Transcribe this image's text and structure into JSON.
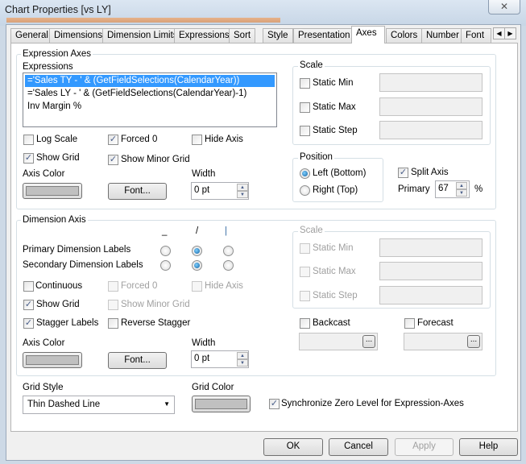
{
  "window": {
    "title": "Chart Properties [vs LY]",
    "close_icon": "close-icon"
  },
  "tabs": [
    "General",
    "Dimensions",
    "Dimension Limits",
    "Expressions",
    "Sort",
    "Style",
    "Presentation",
    "Axes",
    "Colors",
    "Number",
    "Font"
  ],
  "active_tab": "Axes",
  "expression_axes": {
    "group_label": "Expression Axes",
    "expressions_label": "Expressions",
    "expressions": [
      "='Sales TY - '  & (GetFieldSelections(CalendarYear))",
      "='Sales LY - '  & (GetFieldSelections(CalendarYear)-1)",
      "Inv Margin %"
    ],
    "selected_index": 0,
    "log_scale": {
      "label": "Log Scale",
      "checked": false
    },
    "forced_0": {
      "label": "Forced 0",
      "checked": true
    },
    "hide_axis": {
      "label": "Hide Axis",
      "checked": false
    },
    "show_grid": {
      "label": "Show Grid",
      "checked": true
    },
    "show_minor_grid": {
      "label": "Show Minor Grid",
      "checked": true
    },
    "axis_color_label": "Axis Color",
    "axis_color": "#c0c0c0",
    "font_button": "Font...",
    "width_label": "Width",
    "width_value": "0 pt",
    "scale": {
      "label": "Scale",
      "static_min": "Static Min",
      "static_max": "Static Max",
      "static_step": "Static Step"
    },
    "position": {
      "label": "Position",
      "left": "Left (Bottom)",
      "right": "Right (Top)",
      "selected": "Left (Bottom)"
    },
    "split_axis": {
      "label": "Split Axis",
      "checked": true
    },
    "primary_label": "Primary",
    "primary_value": "67",
    "percent": "%"
  },
  "dimension_axis": {
    "group_label": "Dimension Axis",
    "orientation_symbols": [
      "_",
      "/",
      "|"
    ],
    "primary_labels": "Primary Dimension Labels",
    "secondary_labels": "Secondary Dimension Labels",
    "primary_selected": "/",
    "secondary_selected": "/",
    "continuous": {
      "label": "Continuous",
      "checked": false
    },
    "forced_0": {
      "label": "Forced 0",
      "checked": false,
      "disabled": true
    },
    "hide_axis": {
      "label": "Hide Axis",
      "checked": false,
      "disabled": true
    },
    "show_grid": {
      "label": "Show Grid",
      "checked": true
    },
    "show_minor_grid": {
      "label": "Show Minor Grid",
      "checked": false,
      "disabled": true
    },
    "stagger_labels": {
      "label": "Stagger Labels",
      "checked": true
    },
    "reverse_stagger": {
      "label": "Reverse Stagger",
      "checked": false
    },
    "axis_color_label": "Axis Color",
    "axis_color": "#c0c0c0",
    "font_button": "Font...",
    "width_label": "Width",
    "width_value": "0 pt",
    "scale": {
      "label": "Scale",
      "static_min": "Static Min",
      "static_max": "Static Max",
      "static_step": "Static Step"
    },
    "backcast": {
      "label": "Backcast",
      "checked": false,
      "button": "..."
    },
    "forecast": {
      "label": "Forecast",
      "checked": false,
      "button": "..."
    }
  },
  "grid_style": {
    "label": "Grid Style",
    "value": "Thin Dashed Line"
  },
  "grid_color": {
    "label": "Grid Color",
    "color": "#c0c0c0"
  },
  "sync_zero": {
    "label": "Synchronize Zero Level for Expression-Axes",
    "checked": true
  },
  "buttons": {
    "ok": "OK",
    "cancel": "Cancel",
    "apply": "Apply",
    "help": "Help"
  }
}
